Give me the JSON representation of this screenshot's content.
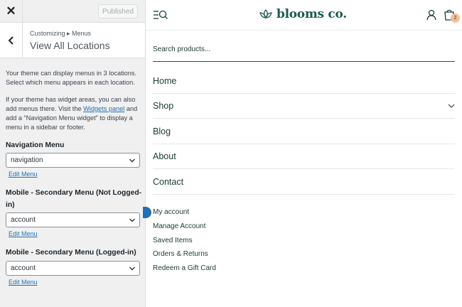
{
  "customizer": {
    "close_label": "✕",
    "published_label": "Published",
    "breadcrumb": "Customizing ▸ Menus",
    "section_title": "View All Locations",
    "description_1": "Your theme can display menus in 3 locations. Select which menu appears in each location.",
    "description_2_pre": "If your theme has widget areas, you can also add menus there. Visit the ",
    "description_2_link": "Widgets panel",
    "description_2_post": " and add a “Navigation Menu widget” to display a menu in a sidebar or footer.",
    "locations": [
      {
        "label": "Navigation Menu",
        "selected": "navigation",
        "edit_label": "Edit Menu"
      },
      {
        "label": "Mobile - Secondary Menu (Not Logged-in)",
        "selected": "account",
        "edit_label": "Edit Menu"
      },
      {
        "label": "Mobile - Secondary Menu (Logged-in)",
        "selected": "account",
        "edit_label": "Edit Menu"
      }
    ]
  },
  "preview": {
    "brand": "blooms co.",
    "cart_count": "2",
    "search_placeholder": "Search products...",
    "nav": [
      "Home",
      "Shop",
      "Blog",
      "About",
      "Contact"
    ],
    "secondary": [
      "My account",
      "Manage Account",
      "Saved Items",
      "Orders & Returns",
      "Redeem a Gift Card"
    ]
  },
  "colors": {
    "brand_green": "#1d5a4f",
    "wp_link": "#2271b1",
    "badge": "#f2c09a"
  },
  "icons": {
    "menu_toggle": "menu-search-icon",
    "account": "user-icon",
    "cart": "shopping-bag-icon",
    "logo": "lotus-icon"
  }
}
